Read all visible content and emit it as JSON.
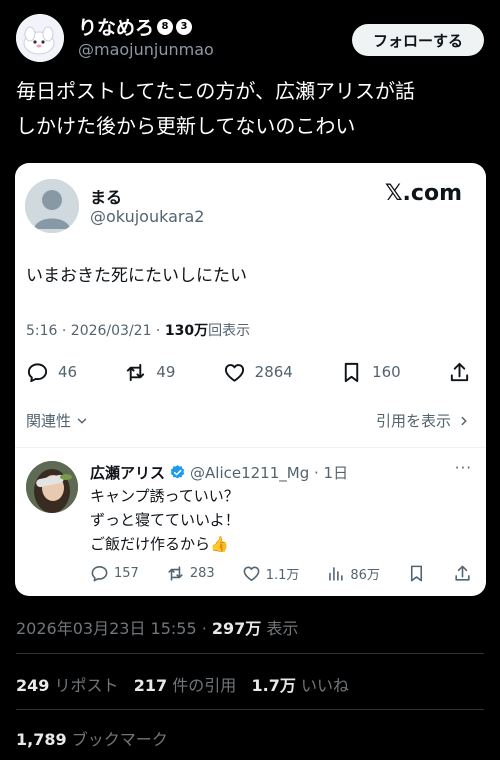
{
  "author": {
    "name": "りなめろ",
    "badges": [
      "8",
      "3"
    ],
    "handle": "@maojunjunmao",
    "follow_label": "フォローする"
  },
  "post": {
    "line1": "毎日ポストしてたこの方が、広瀬アリスが話",
    "line2": "しかけた後から更新してないのこわい"
  },
  "card": {
    "name": "まる",
    "handle": "@okujoukara2",
    "brand": "𝕏.com",
    "text": "いまおきた死にたいしにたい",
    "time": "5:16 · 2026/03/21 · ",
    "views_count": "130万",
    "views_label": "回表示",
    "actions": {
      "replies": "46",
      "reposts": "49",
      "likes": "2864",
      "bookmarks": "160"
    },
    "relevance_label": "関連性",
    "show_quotes_label": "引用を表示"
  },
  "reply": {
    "name": "広瀬アリス",
    "handle_date": "@Alice1211_Mg · 1日",
    "more": "···",
    "line1": "キャンプ誘っていい？",
    "line2": "ずっと寝てていいよ！",
    "line3": "ご飯だけ作るから👍",
    "actions": {
      "replies": "157",
      "reposts": "283",
      "likes": "1.1万",
      "views": "86万"
    }
  },
  "footer": {
    "timestamp": "2026年03月23日 15:55 · ",
    "views_count": "297万",
    "views_label": " 表示",
    "reposts_count": "249",
    "reposts_label": " リポスト",
    "quotes_count": "217",
    "quotes_label": " 件の引用",
    "likes_count": "1.7万",
    "likes_label": " いいね",
    "bookmarks_count": "1,789",
    "bookmarks_label": " ブックマーク"
  },
  "colors": {
    "background": "#000000",
    "card": "#ffffff",
    "verified": "#1d9bf0",
    "muted": "#71767b"
  }
}
